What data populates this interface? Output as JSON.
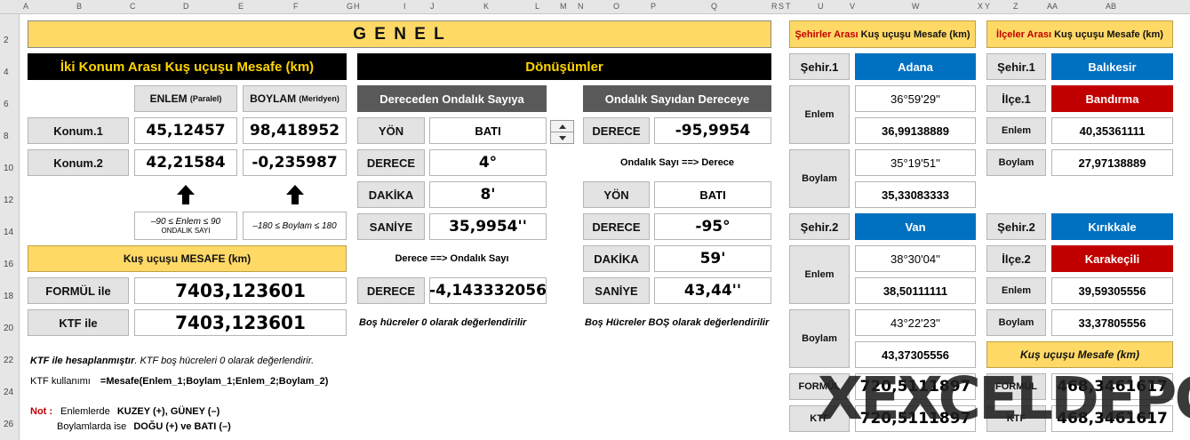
{
  "columns": [
    "A",
    "B",
    "C",
    "D",
    "E",
    "F",
    "G",
    "H",
    "I",
    "J",
    "K",
    "L",
    "M",
    "N",
    "O",
    "P",
    "Q",
    "R",
    "S",
    "T",
    "U",
    "V",
    "W",
    "X",
    "Y",
    "Z",
    "AA",
    "AB"
  ],
  "rows": [
    "2",
    "4",
    "6",
    "8",
    "10",
    "12",
    "14",
    "16",
    "18",
    "20",
    "22",
    "24",
    "26"
  ],
  "banner": "G E N E L",
  "mesafe": {
    "title": "İki Konum Arası Kuş uçuşu Mesafe (km)",
    "enlem_header": "ENLEM",
    "enlem_sub": "(Paralel)",
    "boylam_header": "BOYLAM",
    "boylam_sub": "(Meridyen)",
    "konum1_label": "Konum.1",
    "konum1_enlem": "45,12457",
    "konum1_boylam": "98,418952",
    "konum2_label": "Konum.2",
    "konum2_enlem": "42,21584",
    "konum2_boylam": "-0,235987",
    "enlem_range": "–90 ≤ Enlem ≤ 90",
    "enlem_range_sub": "ONDALIK  SAYI",
    "boylam_range": "–180 ≤ Boylam ≤ 180",
    "result_header": "Kuş uçuşu  MESAFE  (km)",
    "formul_label": "FORMÜL ile",
    "formul_value": "7403,123601",
    "ktf_label": "KTF  ile",
    "ktf_value": "7403,123601"
  },
  "notes": {
    "ktf_bold": "KTF ile hesaplanmıştır",
    "ktf_rest": ". KTF boş hücreleri 0 olarak değerlendirir.",
    "usage_label": "KTF kullanımı",
    "usage_formula": "=Mesafe(Enlem_1;Boylam_1;Enlem_2;Boylam_2)",
    "not_label": "Not :",
    "not_line1_a": "Enlemlerde",
    "not_line1_b": "KUZEY  (+),  GÜNEY (–)",
    "not_line2_a": "Boylamlarda  ise",
    "not_line2_b": "DOĞU (+)  ve  BATI  (–)"
  },
  "donusum": {
    "title": "Dönüşümler",
    "left_header": "Dereceden Ondalık Sayıya",
    "yon_label": "YÖN",
    "yon_value": "BATI",
    "derece_label": "DERECE",
    "derece_value": "4°",
    "dakika_label": "DAKİKA",
    "dakika_value": "8'",
    "saniye_label": "SANİYE",
    "saniye_value": "35,9954''",
    "caption_left": "Derece  ==>  Ondalık Sayı",
    "derece_result_label": "DERECE",
    "derece_result_value": "-4,143332056",
    "foot_left": "Boş hücreler 0 olarak değerlendirilir",
    "right_header": "Ondalık Sayıdan  Dereceye",
    "r_derece_label": "DERECE",
    "r_derece_value": "-95,9954",
    "caption_right": "Ondalık Sayı ==> Derece",
    "r_yon_label": "YÖN",
    "r_yon_value": "BATI",
    "r_derece2_label": "DERECE",
    "r_derece2_value": "-95°",
    "r_dakika_label": "DAKİKA",
    "r_dakika_value": "59'",
    "r_saniye_label": "SANİYE",
    "r_saniye_value": "43,44''",
    "foot_right": "Boş Hücreler BOŞ olarak değerlendirilir"
  },
  "sehirler": {
    "header_a": "Şehirler Arası",
    "header_b": "Kuş uçuşu Mesafe (km)",
    "s1_label": "Şehir.1",
    "s1_name": "Adana",
    "enlem_label": "Enlem",
    "s1_enlem_dms": "36°59'29''",
    "s1_enlem_dec": "36,99138889",
    "boylam_label": "Boylam",
    "s1_boylam_dms": "35°19'51''",
    "s1_boylam_dec": "35,33083333",
    "s2_label": "Şehir.2",
    "s2_name": "Van",
    "s2_enlem_dms": "38°30'04''",
    "s2_enlem_dec": "38,50111111",
    "s2_boylam_dms": "43°22'23''",
    "s2_boylam_dec": "43,37305556",
    "formul_label": "FORMÜL",
    "formul_value": "720,5111897",
    "ktf_label": "KTF",
    "ktf_value": "720,5111897"
  },
  "ilceler": {
    "header_a": "İlçeler Arası",
    "header_b": "Kuş uçuşu Mesafe (km)",
    "s1_label": "Şehir.1",
    "s1_name": "Balıkesir",
    "i1_label": "İlçe.1",
    "i1_name": "Bandırma",
    "enlem_label": "Enlem",
    "i1_enlem": "40,35361111",
    "boylam_label": "Boylam",
    "i1_boylam": "27,97138889",
    "s2_label": "Şehir.2",
    "s2_name": "Kırıkkale",
    "i2_label": "İlçe.2",
    "i2_name": "Karakeçili",
    "i2_enlem": "39,59305556",
    "i2_boylam": "33,37805556",
    "mesafe_header": "Kuş uçuşu Mesafe (km)",
    "formul_label": "FORMÜL",
    "formul_value": "468,3461617",
    "ktf_label": "KTF",
    "ktf_value": "468,3461617"
  },
  "watermark": "XEXCELDEPO",
  "colors": {
    "yellow": "#ffd966",
    "blue": "#0070c0",
    "red": "#c00000",
    "dark": "#595959",
    "black": "#000000",
    "banner_text": "#ffd400"
  }
}
